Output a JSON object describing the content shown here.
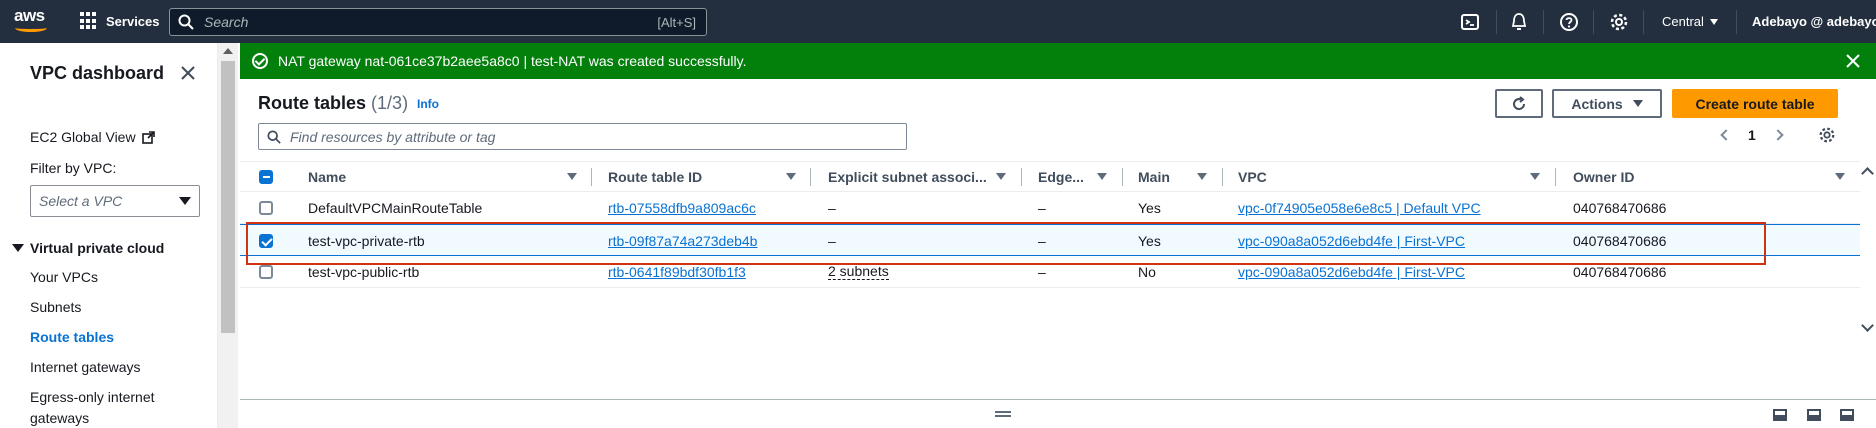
{
  "topnav": {
    "logo_text": "aws",
    "services_label": "Services",
    "search_placeholder": "Search",
    "search_shortcut": "[Alt+S]",
    "region": "Central",
    "account": "Adebayo @ adebayoav"
  },
  "sidebar": {
    "title": "VPC dashboard",
    "ec2_link": "EC2 Global View",
    "filter_label": "Filter by VPC:",
    "filter_placeholder": "Select a VPC",
    "section": "Virtual private cloud",
    "items": [
      {
        "label": "Your VPCs",
        "active": false
      },
      {
        "label": "Subnets",
        "active": false
      },
      {
        "label": "Route tables",
        "active": true
      },
      {
        "label": "Internet gateways",
        "active": false
      },
      {
        "label": "Egress-only internet",
        "active": false
      },
      {
        "label": "gateways",
        "active": false
      }
    ]
  },
  "flash": {
    "message": "NAT gateway nat-061ce37b2aee5a8c0 | test-NAT was created successfully.",
    "color": "#037f0c"
  },
  "main": {
    "title": "Route tables",
    "count": "(1/3)",
    "info": "Info",
    "actions_label": "Actions",
    "create_label": "Create route table",
    "find_placeholder": "Find resources by attribute or tag",
    "page": "1"
  },
  "table": {
    "columns": [
      "Name",
      "Route table ID",
      "Explicit subnet associ...",
      "Edge...",
      "Main",
      "VPC",
      "Owner ID"
    ],
    "rows": [
      {
        "name": "DefaultVPCMainRouteTable",
        "id": "rtb-07558dfb9a809ac6c",
        "subnets": "–",
        "edge": "–",
        "main": "Yes",
        "vpc": "vpc-0f74905e058e6e8c5 | Default VPC",
        "owner": "040768470686",
        "selected": false
      },
      {
        "name": "test-vpc-private-rtb",
        "id": "rtb-09f87a74a273deb4b",
        "subnets": "–",
        "edge": "–",
        "main": "Yes",
        "vpc": "vpc-090a8a052d6ebd4fe | First-VPC",
        "owner": "040768470686",
        "selected": true
      },
      {
        "name": "test-vpc-public-rtb",
        "id": "rtb-0641f89bdf30fb1f3",
        "subnets": "2 subnets",
        "edge": "–",
        "main": "No",
        "vpc": "vpc-090a8a052d6ebd4fe | First-VPC",
        "owner": "040768470686",
        "selected": false
      }
    ]
  },
  "colors": {
    "nav_bg": "#232f3e",
    "accent": "#ff9900",
    "link": "#0972d3",
    "highlight": "#d13212"
  }
}
